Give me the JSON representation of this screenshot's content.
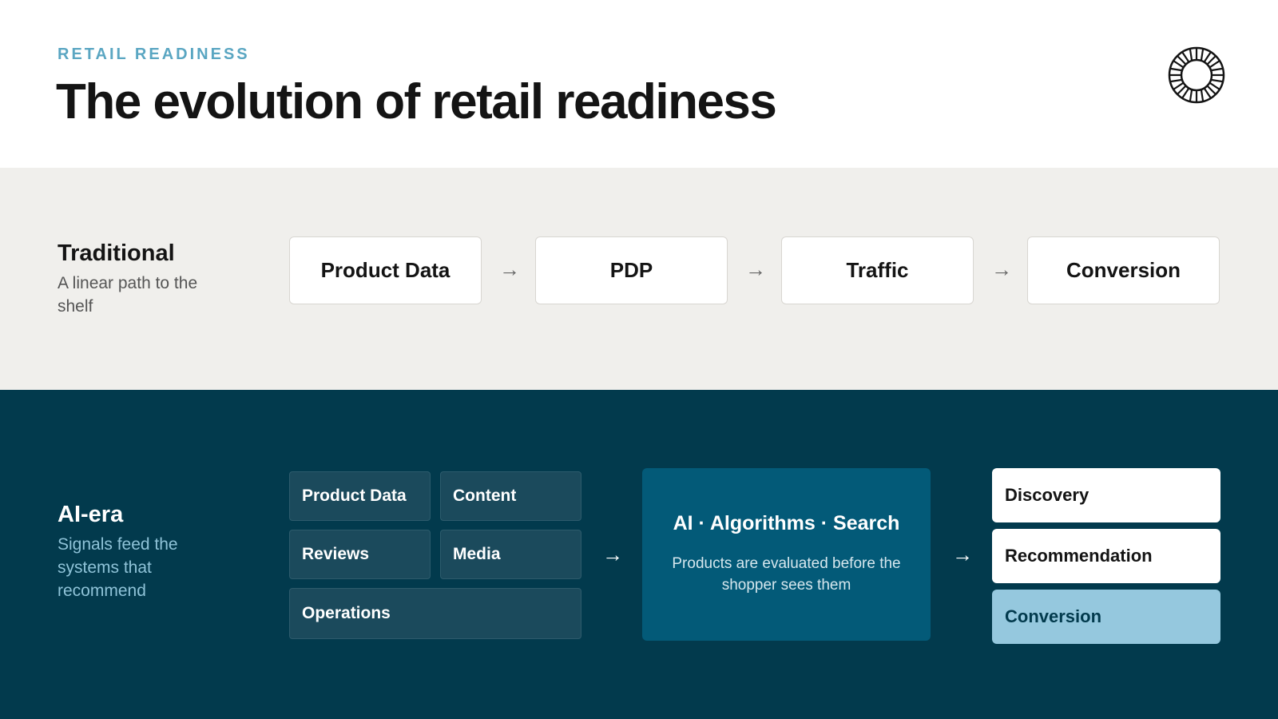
{
  "header": {
    "eyebrow": "RETAIL READINESS",
    "title": "The evolution of retail readiness"
  },
  "logo": {
    "icon": "circular-wordmark-seal-icon"
  },
  "traditional": {
    "label": "Traditional",
    "description": "A linear path to the shelf",
    "steps": [
      "Product Data",
      "PDP",
      "Traffic",
      "Conversion"
    ],
    "arrow": "→"
  },
  "ai_era": {
    "label": "AI-era",
    "description": "Signals feed the systems that recommend",
    "signals": [
      "Product Data",
      "Content",
      "Reviews",
      "Media",
      "Operations"
    ],
    "engine": {
      "title": "AI · Algorithms · Search",
      "subtitle": "Products are evaluated before the shopper sees them"
    },
    "outcomes": [
      "Discovery",
      "Recommendation",
      "Conversion"
    ],
    "arrow": "→"
  },
  "colors": {
    "accent": "#5aa6c2",
    "dark_band": "#023a4d",
    "light_band": "#f0efec",
    "engine": "#035a78",
    "signal_box": "#1b4a5c",
    "highlight": "#95c8de"
  }
}
